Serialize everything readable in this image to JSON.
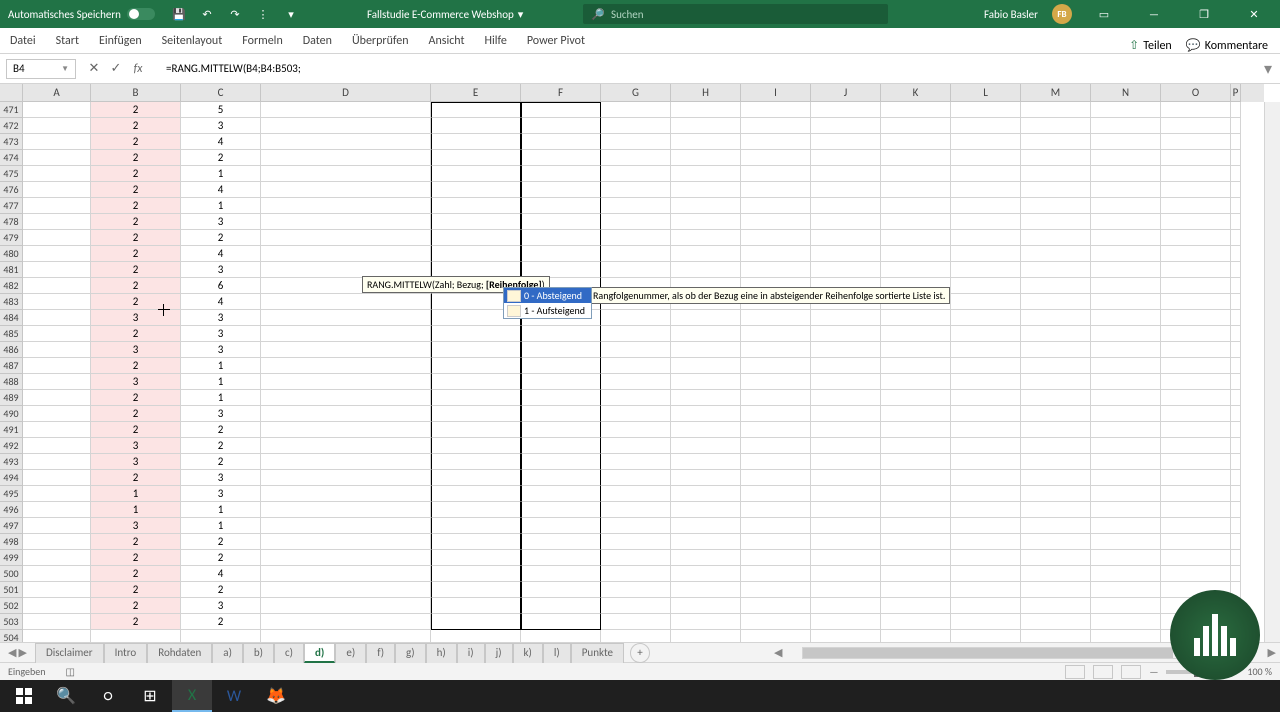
{
  "titlebar": {
    "autosave_label": "Automatisches Speichern",
    "doc_title": "Fallstudie E-Commerce Webshop",
    "search_placeholder": "Suchen",
    "user_name": "Fabio Basler",
    "user_initials": "FB"
  },
  "ribbon": {
    "tabs": [
      "Datei",
      "Start",
      "Einfügen",
      "Seitenlayout",
      "Formeln",
      "Daten",
      "Überprüfen",
      "Ansicht",
      "Hilfe",
      "Power Pivot"
    ],
    "teilen": "Teilen",
    "kommentare": "Kommentare"
  },
  "formula_bar": {
    "name_box": "B4",
    "formula": "=RANG.MITTELW(B4;B4:B503;"
  },
  "columns": [
    "A",
    "B",
    "C",
    "D",
    "E",
    "F",
    "G",
    "H",
    "I",
    "J",
    "K",
    "L",
    "M",
    "N",
    "O",
    "P"
  ],
  "rows": [
    {
      "n": 471,
      "b": "2",
      "c": "5"
    },
    {
      "n": 472,
      "b": "2",
      "c": "3"
    },
    {
      "n": 473,
      "b": "2",
      "c": "4"
    },
    {
      "n": 474,
      "b": "2",
      "c": "2"
    },
    {
      "n": 475,
      "b": "2",
      "c": "1"
    },
    {
      "n": 476,
      "b": "2",
      "c": "4"
    },
    {
      "n": 477,
      "b": "2",
      "c": "1"
    },
    {
      "n": 478,
      "b": "2",
      "c": "3"
    },
    {
      "n": 479,
      "b": "2",
      "c": "2"
    },
    {
      "n": 480,
      "b": "2",
      "c": "4"
    },
    {
      "n": 481,
      "b": "2",
      "c": "3"
    },
    {
      "n": 482,
      "b": "2",
      "c": "6"
    },
    {
      "n": 483,
      "b": "2",
      "c": "4"
    },
    {
      "n": 484,
      "b": "3",
      "c": "3"
    },
    {
      "n": 485,
      "b": "2",
      "c": "3"
    },
    {
      "n": 486,
      "b": "3",
      "c": "3"
    },
    {
      "n": 487,
      "b": "2",
      "c": "1"
    },
    {
      "n": 488,
      "b": "3",
      "c": "1"
    },
    {
      "n": 489,
      "b": "2",
      "c": "1"
    },
    {
      "n": 490,
      "b": "2",
      "c": "3"
    },
    {
      "n": 491,
      "b": "2",
      "c": "2"
    },
    {
      "n": 492,
      "b": "3",
      "c": "2"
    },
    {
      "n": 493,
      "b": "3",
      "c": "2"
    },
    {
      "n": 494,
      "b": "2",
      "c": "3"
    },
    {
      "n": 495,
      "b": "1",
      "c": "3"
    },
    {
      "n": 496,
      "b": "1",
      "c": "1"
    },
    {
      "n": 497,
      "b": "3",
      "c": "1"
    },
    {
      "n": 498,
      "b": "2",
      "c": "2"
    },
    {
      "n": 499,
      "b": "2",
      "c": "2"
    },
    {
      "n": 500,
      "b": "2",
      "c": "4"
    },
    {
      "n": 501,
      "b": "2",
      "c": "2"
    },
    {
      "n": 502,
      "b": "2",
      "c": "3"
    },
    {
      "n": 503,
      "b": "2",
      "c": "2"
    },
    {
      "n": 504,
      "b": "",
      "c": ""
    }
  ],
  "tooltip": {
    "syntax_prefix": "RANG.MITTELW(Zahl; Bezug; ",
    "syntax_bold": "[Reihenfolge]",
    "syntax_suffix": ")",
    "option0": "0 - Absteigend",
    "option1": "1 - Aufsteigend",
    "desc": "Rangfolgenummer, als ob der Bezug eine in absteigender Reihenfolge sortierte Liste ist."
  },
  "sheet_tabs": [
    "Disclaimer",
    "Intro",
    "Rohdaten",
    "a)",
    "b)",
    "c)",
    "d)",
    "e)",
    "f)",
    "g)",
    "h)",
    "i)",
    "j)",
    "k)",
    "l)",
    "Punkte"
  ],
  "active_sheet": "d)",
  "statusbar": {
    "mode": "Eingeben",
    "zoom": "100 %"
  }
}
